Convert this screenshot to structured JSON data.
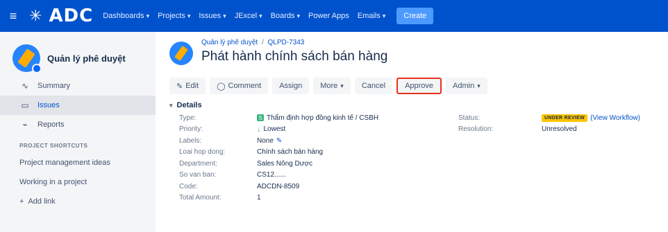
{
  "topbar": {
    "logo_text": "ADC",
    "nav": [
      {
        "label": "Dashboards"
      },
      {
        "label": "Projects"
      },
      {
        "label": "Issues"
      },
      {
        "label": "JExcel"
      },
      {
        "label": "Boards"
      },
      {
        "label": "Power Apps"
      },
      {
        "label": "Emails"
      }
    ],
    "nav_dropdown_flags": [
      true,
      true,
      true,
      true,
      true,
      false,
      true
    ],
    "create_label": "Create"
  },
  "sidebar": {
    "project_name": "Quản lý phê duyệt",
    "items": [
      {
        "label": "Summary",
        "icon": "summary-icon"
      },
      {
        "label": "Issues",
        "icon": "issues-icon"
      },
      {
        "label": "Reports",
        "icon": "reports-icon"
      }
    ],
    "shortcuts_header": "PROJECT SHORTCUTS",
    "shortcuts": [
      "Project management ideas",
      "Working in a project"
    ],
    "add_link_label": "Add link"
  },
  "issue": {
    "breadcrumb_project": "Quản lý phê duyệt",
    "breadcrumb_key": "QLPD-7343",
    "title": "Phát hành chính sách bán hàng"
  },
  "toolbar": {
    "edit": "Edit",
    "comment": "Comment",
    "assign": "Assign",
    "more": "More",
    "cancel": "Cancel",
    "approve": "Approve",
    "admin": "Admin"
  },
  "details": {
    "header": "Details",
    "type_label": "Type:",
    "type_value": "Thẩm định hợp đồng kinh tế / CSBH",
    "priority_label": "Priority:",
    "priority_value": "Lowest",
    "labels_label": "Labels:",
    "labels_value": "None",
    "loai_label": "Loai hop dong:",
    "loai_value": "Chính sách bán hàng",
    "department_label": "Department:",
    "department_value": "Sales Nông Dược",
    "sovanban_label": "So van ban:",
    "sovanban_value": "CS12......",
    "code_label": "Code:",
    "code_value": "ADCDN-8509",
    "total_label": "Total Amount:",
    "total_value": "1",
    "status_label": "Status:",
    "status_value": "UNDER REVIEW",
    "workflow_link": "(View Workflow)",
    "resolution_label": "Resolution:",
    "resolution_value": "Unresolved"
  },
  "colors": {
    "topbar": "#0052cc",
    "status_badge": "#ffc400",
    "approve_highlight": "#e5311f"
  }
}
